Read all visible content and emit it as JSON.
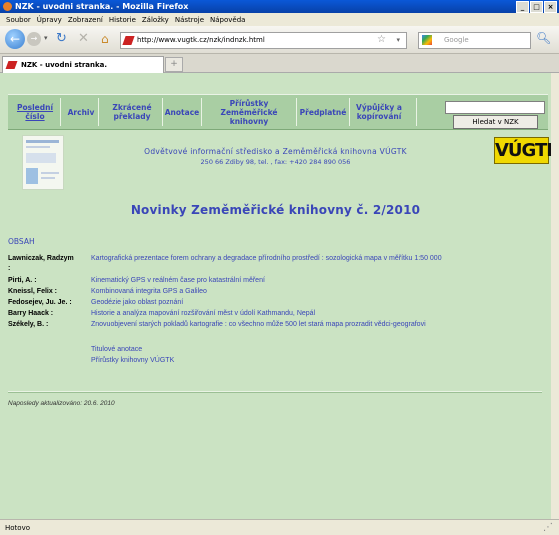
{
  "window": {
    "title": "NZK - uvodni stranka. - Mozilla Firefox",
    "controls": [
      "_",
      "□",
      "×"
    ]
  },
  "menu": [
    "Soubor",
    "Úpravy",
    "Zobrazení",
    "Historie",
    "Záložky",
    "Nástroje",
    "Nápověda"
  ],
  "toolbar": {
    "url": "http://www.vugtk.cz/nzk/indnzk.html",
    "search_placeholder": "Google"
  },
  "tabs": [
    {
      "label": "NZK - uvodni stranka."
    }
  ],
  "newtab": "+",
  "site_nav": {
    "items": [
      "Poslední číslo",
      "Archiv",
      "Zkrácené překlady",
      "Anotace",
      "Přírůstky Zeměměřické knihovny",
      "Předplatné",
      "Výpůjčky a kopírování"
    ],
    "search_button": "Hledat v NZK"
  },
  "header": {
    "org_name": "Odvětvové informační středisko a Zeměměřická knihovna VÚGTK",
    "org_address": "250 66 Zdiby 98, tel. , fax: +420 284 890 056",
    "logo_text": "VÚGTK"
  },
  "main": {
    "title": "Novinky Zeměměřické knihovny č. 2/2010",
    "contents_heading": "OBSAH",
    "articles": [
      {
        "author": "Lawniczak, Radzym",
        "title": "Kartografická prezentace forem ochrany a degradace přírodního prostředí : sozologická mapa v měřítku 1:50 000"
      },
      {
        "author": "Pirti, A. :",
        "title": "Kinematický GPS v reálném čase pro katastrální měření"
      },
      {
        "author": "Kneissl, Felix :",
        "title": "Kombinovaná integrita GPS a Galileo"
      },
      {
        "author": "Fedosejev, Ju. Je. :",
        "title": "Geodézie jako oblast poznání"
      },
      {
        "author": "Barry Haack :",
        "title": "Historie a analýza mapování rozšiřování měst v údolí Kathmandu, Nepál"
      },
      {
        "author": "Székely, B. :",
        "title": "Znovuobjevení starých pokladů kartografie : co všechno může 500 let stará mapa prozradit vědci-geografovi"
      }
    ],
    "colon": ":",
    "extra_links": [
      "Titulové anotace",
      "Přírůstky knihovny VÚGTK"
    ],
    "updated": "Naposledy aktualizováno: 20.6. 2010"
  },
  "status": "Hotovo"
}
